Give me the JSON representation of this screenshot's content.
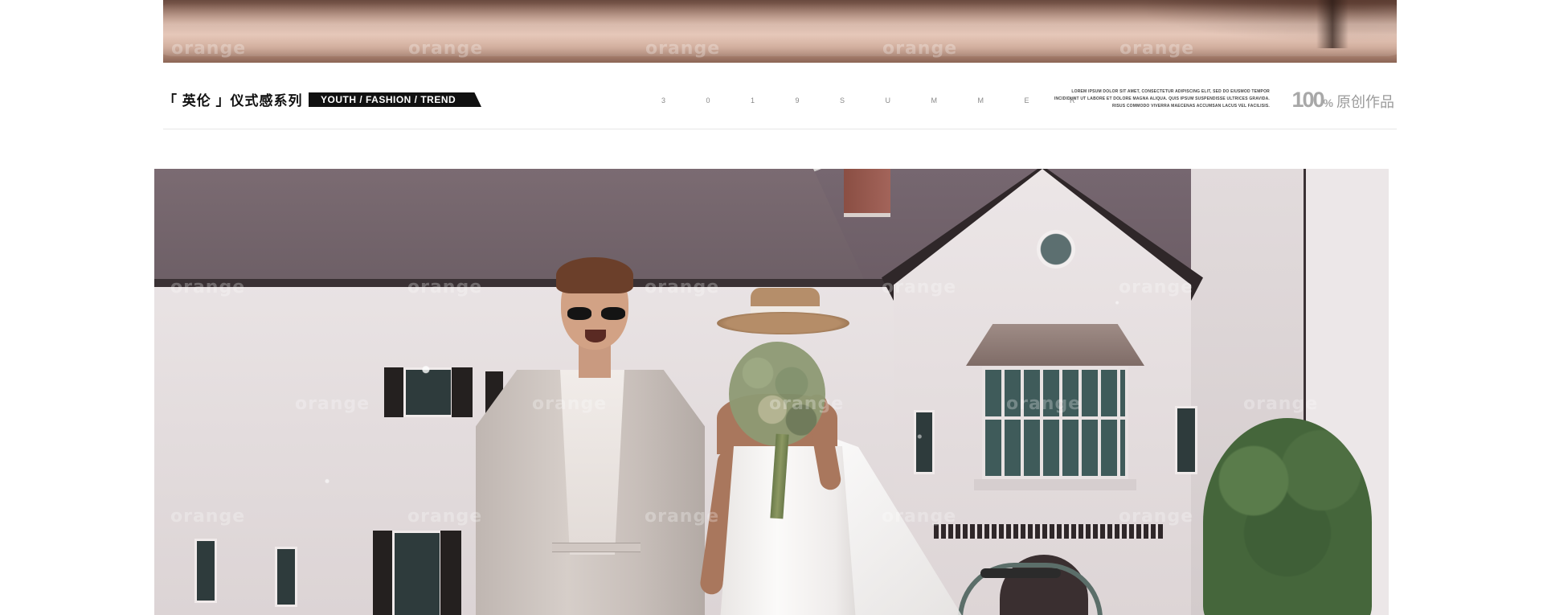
{
  "watermark": {
    "text": "orange"
  },
  "header": {
    "series_title": "「 英伦 」仪式感系列",
    "tagline": "YOUTH  /  FASHION  /  TREND",
    "summer": "3 0 1 9 S U M M E R",
    "lorem_lines": [
      "LOREM IPSUM DOLOR SIT AMET, CONSECTETUR ADIPISCING ELIT, SED DO EIUSMOD TEMPOR",
      "INCIDIDUNT UT LABORE ET DOLORE MAGNA ALIQUA. QUIS IPSUM SUSPENDISSE ULTRICES GRAVIDA.",
      "RISUS COMMODO VIVERRA MAECENAS ACCUMSAN LACUS VEL FACILISIS."
    ],
    "original": {
      "number": "100",
      "percent": "%",
      "text": "原创作品"
    }
  },
  "colors": {
    "tag_bg": "#111111",
    "original_gray": "#a8a8a8",
    "divider": "#e6e6e6"
  }
}
